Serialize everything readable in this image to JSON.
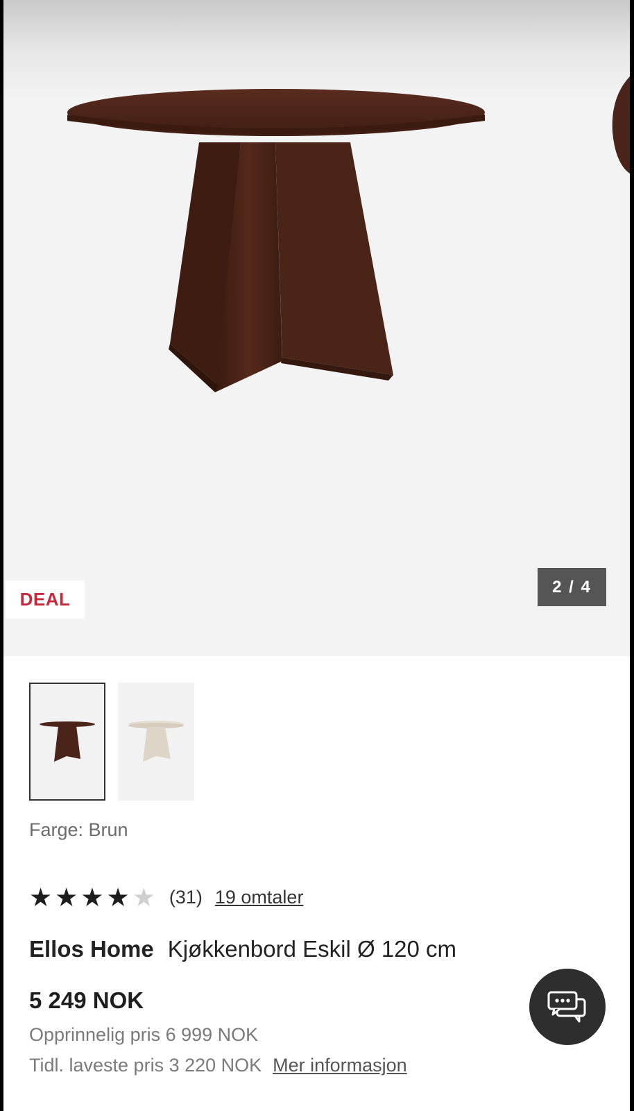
{
  "gallery": {
    "badge": "DEAL",
    "counter": "2 / 4",
    "colors": {
      "badge_text": "#c8283c",
      "counter_bg": "#555555",
      "wood": "#4a2418"
    }
  },
  "variants": [
    {
      "name": "brown-variant",
      "selected": true
    },
    {
      "name": "white-variant",
      "selected": false
    }
  ],
  "color_label": "Farge: Brun",
  "rating": {
    "stars_filled": 4,
    "stars_total": 5,
    "count": "(31)",
    "reviews_link": "19 omtaler"
  },
  "product": {
    "brand": "Ellos Home",
    "name": "Kjøkkenbord Eskil Ø 120 cm"
  },
  "pricing": {
    "price": "5 249 NOK",
    "original": "Opprinnelig pris 6 999 NOK",
    "lowest": "Tidl. laveste pris 3 220 NOK",
    "more_info": "Mer informasjon"
  },
  "chat": {
    "icon": "chat-bubbles-icon"
  }
}
